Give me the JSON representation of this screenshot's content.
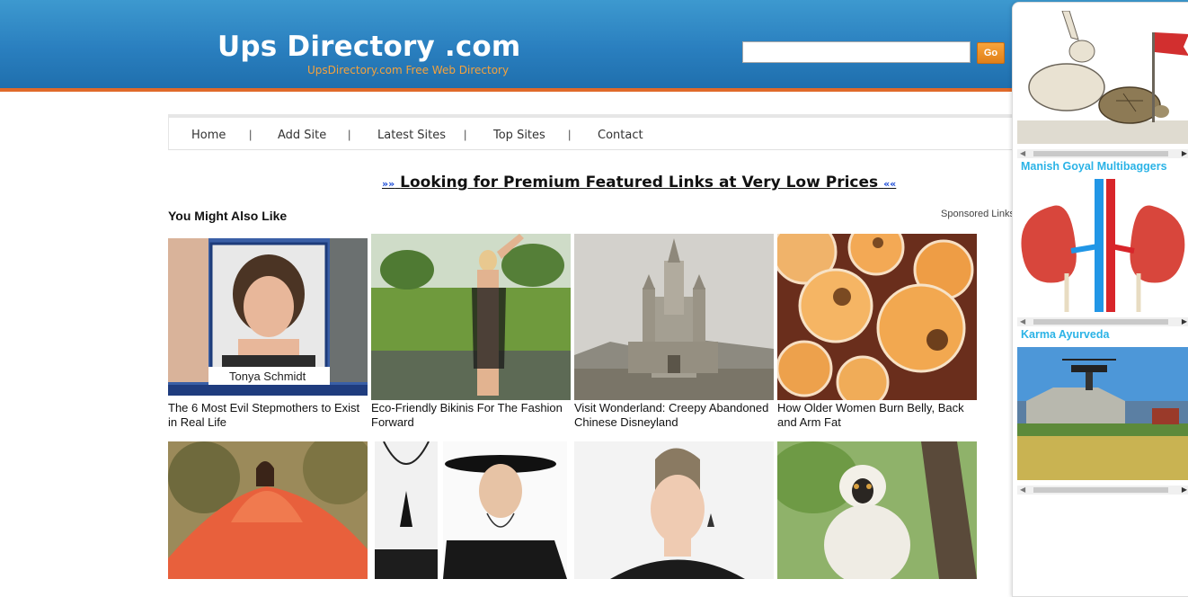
{
  "header": {
    "title": "Ups Directory .com",
    "subtitle": "UpsDirectory.com Free Web Directory",
    "search_value": "",
    "go_label": "Go"
  },
  "nav": {
    "items": [
      "Home",
      "Add Site",
      "Latest Sites",
      "Top Sites",
      "Contact"
    ],
    "separator": "|"
  },
  "promo": {
    "left_arrows": "»»",
    "text": "Looking for Premium Featured Links at Very Low Prices",
    "right_arrows": "««"
  },
  "section": {
    "title": "You Might Also Like",
    "sponsored": "Sponsored Links"
  },
  "cards": [
    {
      "caption": "The 6 Most Evil Stepmothers to Exist in Real Life",
      "image_text": "Tonya Schmidt"
    },
    {
      "caption": "Eco-Friendly Bikinis For The Fashion Forward"
    },
    {
      "caption": "Visit Wonderland: Creepy Abandoned Chinese Disneyland"
    },
    {
      "caption": "How Older Women Burn Belly, Back and Arm Fat"
    }
  ],
  "ads": [
    {
      "label": "Manish Goyal Multibaggers"
    },
    {
      "label": "Karma Ayurveda"
    },
    {
      "label": ""
    }
  ],
  "colors": {
    "header_blue": "#2a7fbf",
    "accent_orange": "#e06a2a",
    "ad_label_cyan": "#2bb3e6"
  }
}
